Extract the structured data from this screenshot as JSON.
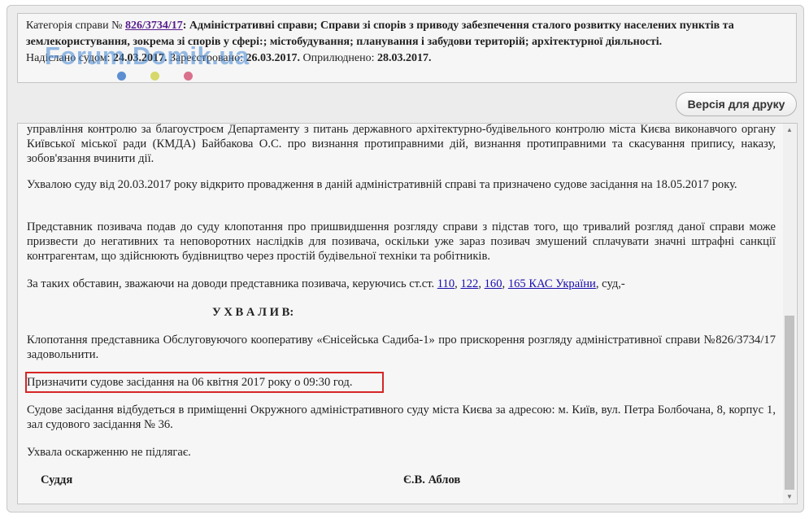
{
  "header": {
    "category_prefix": "Категорія справи № ",
    "case_number": "826/3734/17",
    "category_text": ": Адміністративні справи; Справи зі спорів з приводу забезпечення сталого розвитку населених пунктів та землекористування, зокрема зі спорів у сфері:; містобудування; планування і забудови територій; архітектурної діяльності.",
    "sent_label": "Надіслано судом: ",
    "sent_date": "24.03.2017.",
    "registered_label": " Зареєстровано: ",
    "registered_date": "26.03.2017.",
    "published_label": " Оприлюднено: ",
    "published_date": "28.03.2017."
  },
  "watermark": {
    "text": "Forum.Domik.ua",
    "dot_colors": [
      "#5b8fd1",
      "#d6d86a",
      "#d9708c"
    ]
  },
  "toolbar": {
    "print_label": "Версія для друку"
  },
  "document": {
    "p0": "управління контролю за благоустроєм Департаменту з питань державного архітектурно-будівельного контролю міста Києва виконавчого органу Київської міської ради (КМДА) Байбакова О.С. про визнання протиправними дій, визнання протиправними та скасування припису, наказу, зобов'язання вчинити дії.",
    "p1": "Ухвалою суду від 20.03.2017 року відкрито провадження в даній адміністративній справі та призначено судове засідання на 18.05.2017 року.",
    "p2": "Представник позивача подав до суду клопотання про пришвидшення розгляду справи з підстав того, що тривалий розгляд даної справи може призвести до негативних та неповоротних наслідків для позивача, оскільки уже зараз позивач змушений сплачувати значні штрафні санкції контрагентам, що здійснюють будівництво через простій будівельної техніки та робітників.",
    "p3_prefix": "За таких обставин, зважаючи на доводи представника позивача, керуючись ст.ст. ",
    "p3_links": [
      "110",
      "122",
      "160",
      "165 КАС України"
    ],
    "p3_separator": ", ",
    "p3_suffix": ", суд,-",
    "heading": "У Х В А Л И В:",
    "p4": "Клопотання представника Обслуговуючого кооперативу «Єнісейська Садиба-1» про прискорення розгляду адміністративної справи №826/3734/17 задовольнити.",
    "p5": "Призначити судове засідання на 06 квітня 2017 року о 09:30 год.",
    "p6": "Судове засідання відбудеться в приміщенні Окружного адміністративного суду міста Києва за адресою: м. Київ, вул. Петра Болбочана, 8, корпус 1, зал судового засідання № 36.",
    "p7": "Ухвала оскарженню не підлягає.",
    "signature_label": "Суддя",
    "signature_name": "Є.В. Аблов"
  }
}
